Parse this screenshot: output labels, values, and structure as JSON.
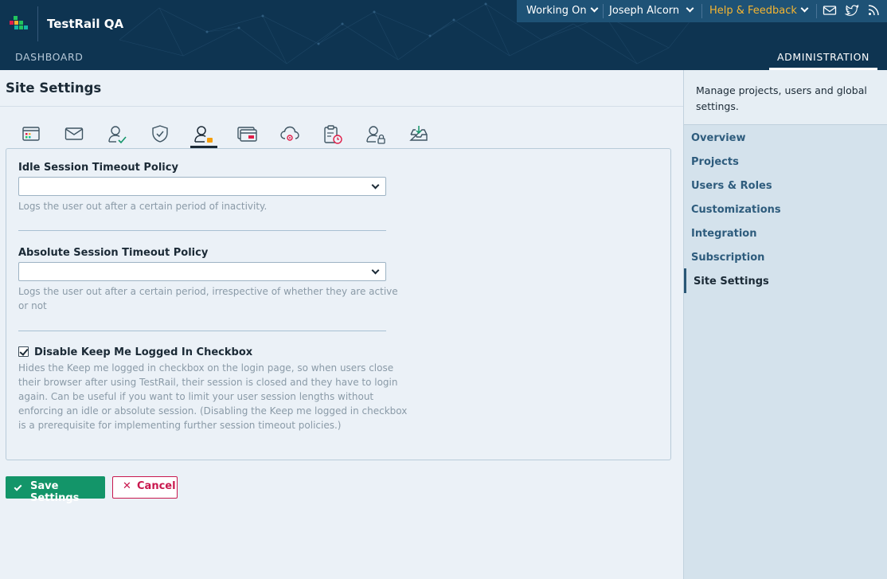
{
  "header": {
    "app_title": "TestRail QA",
    "nav": {
      "dashboard": "DASHBOARD",
      "administration": "ADMINISTRATION"
    },
    "topbar": {
      "working_on": "Working On",
      "user": "Joseph Alcorn",
      "help": "Help & Feedback",
      "icons": [
        "mail-icon",
        "twitter-icon",
        "rss-icon"
      ]
    },
    "logo_colors": [
      "#e11d48",
      "#f5b531",
      "#22c55e",
      "#14b8a6"
    ]
  },
  "page": {
    "title": "Site Settings"
  },
  "tabs": [
    {
      "name": "tab-application",
      "icon": "application-settings-icon"
    },
    {
      "name": "tab-email",
      "icon": "mail-icon"
    },
    {
      "name": "tab-login",
      "icon": "user-check-icon"
    },
    {
      "name": "tab-security",
      "icon": "shield-check-icon"
    },
    {
      "name": "tab-session",
      "icon": "user-session-icon",
      "active": true
    },
    {
      "name": "tab-api",
      "icon": "card-icon"
    },
    {
      "name": "tab-cloud",
      "icon": "cloud-gear-icon"
    },
    {
      "name": "tab-backup",
      "icon": "clipboard-clock-icon"
    },
    {
      "name": "tab-user-lock",
      "icon": "user-lock-icon"
    },
    {
      "name": "tab-import",
      "icon": "inbox-download-icon"
    }
  ],
  "form": {
    "idle": {
      "label": "Idle Session Timeout Policy",
      "value": "",
      "help": "Logs the user out after a certain period of inactivity."
    },
    "absolute": {
      "label": "Absolute Session Timeout Policy",
      "value": "",
      "help_line1": "Logs the user out after a certain period, irrespective of whether they are active",
      "help_line2": "or not"
    },
    "keep_logged_in": {
      "label": "Disable Keep Me Logged In Checkbox",
      "checked": true,
      "help_lines": [
        "Hides the Keep me logged in checkbox on the login page, so when users close",
        "their browser after using TestRail, their session is closed and they have to login",
        "again. Can be useful if you want to limit your user session lengths without",
        "enforcing an idle or absolute session. (Disabling the Keep me logged in checkbox",
        "is a prerequisite for implementing further session timeout policies.)"
      ]
    }
  },
  "buttons": {
    "save": "Save Settings",
    "cancel": "Cancel"
  },
  "sidebar": {
    "description": "Manage projects, users and global settings.",
    "items": [
      "Overview",
      "Projects",
      "Users & Roles",
      "Customizations",
      "Integration",
      "Subscription",
      "Site Settings"
    ],
    "active_item": "Site Settings"
  },
  "colors": {
    "header_bg": "#0e3451",
    "topbar_bg": "#1e5276",
    "help_accent": "#f5b531",
    "save_green": "#139569",
    "cancel_red": "#c9184e"
  }
}
